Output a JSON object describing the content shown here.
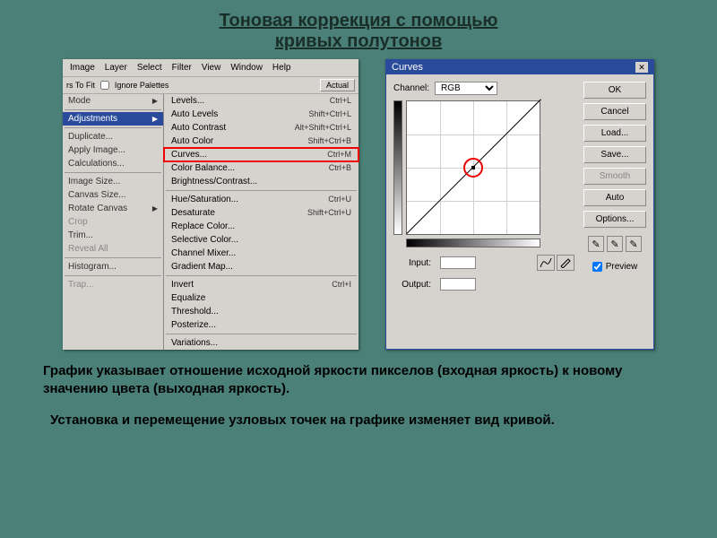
{
  "title": {
    "line1": "Тоновая коррекция с помощью",
    "line2": "кривых полутонов"
  },
  "menubar": [
    "Image",
    "Layer",
    "Select",
    "Filter",
    "View",
    "Window",
    "Help"
  ],
  "toolbar": {
    "fit": "rs To Fit",
    "ignore": "Ignore Palettes",
    "actual": "Actual"
  },
  "leftMenu": [
    {
      "t": "Mode",
      "arrow": true
    },
    {
      "sep": true
    },
    {
      "t": "Adjustments",
      "arrow": true,
      "sel": true
    },
    {
      "sep": true
    },
    {
      "t": "Duplicate..."
    },
    {
      "t": "Apply Image..."
    },
    {
      "t": "Calculations..."
    },
    {
      "sep": true
    },
    {
      "t": "Image Size..."
    },
    {
      "t": "Canvas Size..."
    },
    {
      "t": "Rotate Canvas",
      "arrow": true
    },
    {
      "t": "Crop",
      "disabled": true
    },
    {
      "t": "Trim..."
    },
    {
      "t": "Reveal All",
      "disabled": true
    },
    {
      "sep": true
    },
    {
      "t": "Histogram..."
    },
    {
      "sep": true
    },
    {
      "t": "Trap...",
      "disabled": true
    }
  ],
  "rightMenu": [
    {
      "t": "Levels...",
      "sc": "Ctrl+L"
    },
    {
      "t": "Auto Levels",
      "sc": "Shift+Ctrl+L"
    },
    {
      "t": "Auto Contrast",
      "sc": "Alt+Shift+Ctrl+L"
    },
    {
      "t": "Auto Color",
      "sc": "Shift+Ctrl+B"
    },
    {
      "t": "Curves...",
      "sc": "Ctrl+M",
      "hl": true
    },
    {
      "t": "Color Balance...",
      "sc": "Ctrl+B"
    },
    {
      "t": "Brightness/Contrast..."
    },
    {
      "sep": true
    },
    {
      "t": "Hue/Saturation...",
      "sc": "Ctrl+U"
    },
    {
      "t": "Desaturate",
      "sc": "Shift+Ctrl+U"
    },
    {
      "t": "Replace Color..."
    },
    {
      "t": "Selective Color..."
    },
    {
      "t": "Channel Mixer..."
    },
    {
      "t": "Gradient Map..."
    },
    {
      "sep": true
    },
    {
      "t": "Invert",
      "sc": "Ctrl+I"
    },
    {
      "t": "Equalize"
    },
    {
      "t": "Threshold..."
    },
    {
      "t": "Posterize..."
    },
    {
      "sep": true
    },
    {
      "t": "Variations..."
    }
  ],
  "curves": {
    "title": "Curves",
    "channel_label": "Channel:",
    "channel_value": "RGB",
    "input": "Input:",
    "output": "Output:",
    "buttons": {
      "ok": "OK",
      "cancel": "Cancel",
      "load": "Load...",
      "save": "Save...",
      "smooth": "Smooth",
      "auto": "Auto",
      "options": "Options..."
    },
    "preview": "Preview"
  },
  "caption1": "График указывает отношение исходной яркости пикселов (входная яркость) к новому значению цвета (выходная яркость).",
  "caption2": "Установка и перемещение узловых точек на графике изменяет вид кривой."
}
